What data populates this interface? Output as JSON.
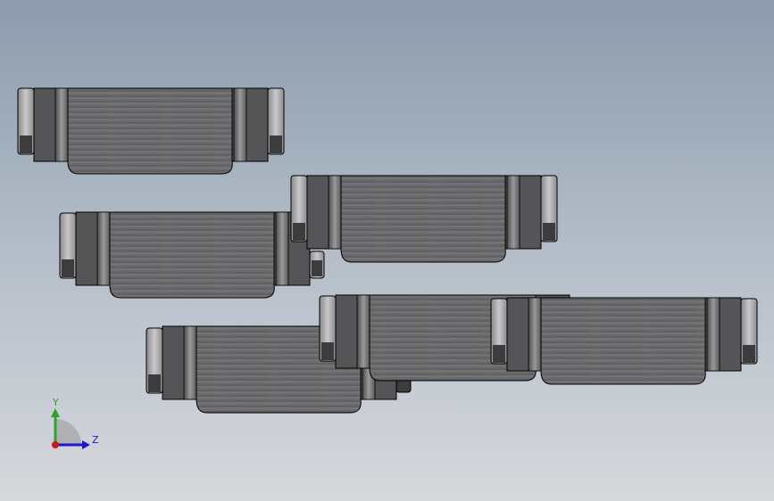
{
  "scene": {
    "background_top": "#8c9bad",
    "background_bottom": "#d6d8dc",
    "part_body_color": "#6e6e70",
    "part_edge_color": "#000000",
    "nut_color": "#a6a6a8"
  },
  "triad": {
    "y_label": "Y",
    "z_label": "Z",
    "y_color": "#2aa52a",
    "z_color": "#1a1acc",
    "x_color": "#cc1a1a"
  }
}
